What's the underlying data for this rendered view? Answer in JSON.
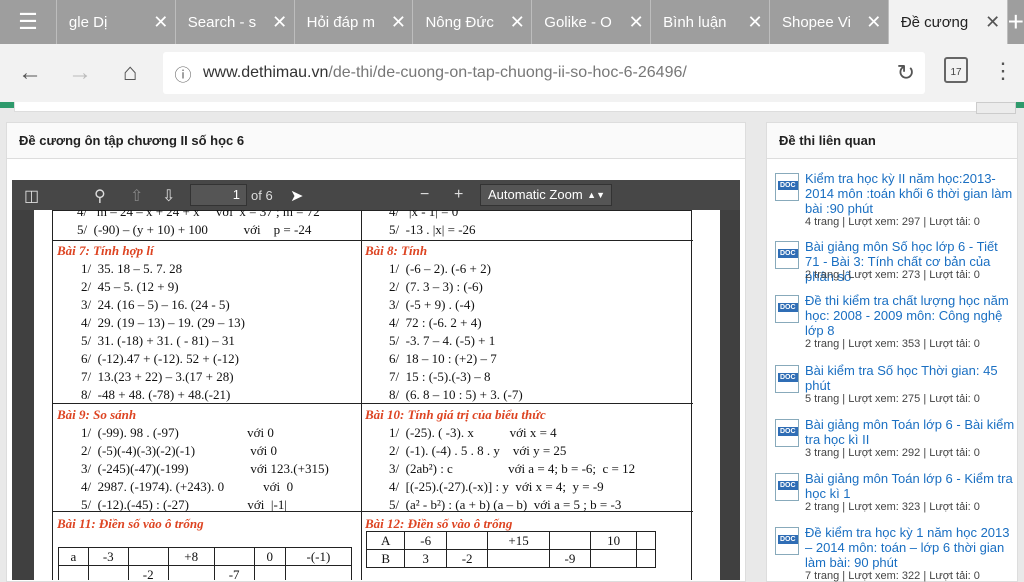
{
  "tabs": [
    {
      "label": "gle Dị"
    },
    {
      "label": "Search - s"
    },
    {
      "label": "Hỏi đáp m"
    },
    {
      "label": "Nông Đức"
    },
    {
      "label": "Golike - O"
    },
    {
      "label": "Bình luận"
    },
    {
      "label": "Shopee Vi"
    },
    {
      "label": "Đề cương"
    }
  ],
  "url": {
    "domain": "www.dethimau.vn",
    "path": "/de-thi/de-cuong-on-tap-chuong-ii-so-hoc-6-26496/"
  },
  "calendar_day": "17",
  "left_title": "Đề cương ôn tập chương II số học 6",
  "viewer": {
    "page": "1",
    "of": "of 6",
    "zoom": "Automatic Zoom"
  },
  "doc": {
    "top_left": [
      "4/   m – 24 – x + 24 + x     với  x = 37 ; m = 72",
      "5/  (-90) – (y + 10) + 100           với    p = -24"
    ],
    "top_right": [
      "4/   |x - 1| = 0",
      "5/  -13 . |x| = -26"
    ],
    "b7_title": "Bài 7:   Tính hợp lí",
    "b7": [
      "1/  35. 18 – 5. 7. 28",
      "2/  45 – 5. (12 + 9)",
      "3/  24. (16 – 5) – 16. (24 - 5)",
      "4/  29. (19 – 13) – 19. (29 – 13)",
      "5/  31. (-18) + 31. ( - 81) – 31",
      "6/  (-12).47 + (-12). 52 + (-12)",
      "7/  13.(23 + 22) – 3.(17 + 28)",
      "8/  -48 + 48. (-78) + 48.(-21)"
    ],
    "b8_title": "Bài 8:   Tính",
    "b8": [
      "1/  (-6 – 2). (-6 + 2)",
      "2/  (7. 3 – 3) : (-6)",
      "3/  (-5 + 9) . (-4)",
      "4/  72 : (-6. 2 + 4)",
      "5/  -3. 7 – 4. (-5) + 1",
      "6/  18 – 10 : (+2) – 7",
      "7/  15 : (-5).(-3) – 8",
      "8/  (6. 8 – 10 : 5) + 3. (-7)"
    ],
    "b9_title": "Bài 9:   So sánh",
    "b9": [
      "1/  (-99). 98 . (-97)                     với 0",
      "2/  (-5)(-4)(-3)(-2)(-1)                 với 0",
      "3/  (-245)(-47)(-199)                   với 123.(+315)",
      "4/  2987. (-1974). (+243). 0            với  0",
      "5/  (-12).(-45) : (-27)                  với  |-1|"
    ],
    "b10_title": "Bài 10:   Tính giá trị của biểu thức",
    "b10": [
      "1/  (-25). ( -3). x           với x = 4",
      "2/  (-1). (-4) . 5 . 8 . y    với y = 25",
      "3/  (2ab²) : c                 với a = 4; b = -6;  c = 12",
      "4/  [(-25).(-27).(-x)] : y  với x = 4;  y = -9",
      "5/  (a² - b²) : (a + b) (a – b)  với a = 5 ; b = -3"
    ],
    "b11_title": "Bài 11:   Điền số vào ô trống",
    "b11_row": [
      "a",
      "-3",
      "",
      "+8",
      "",
      "0",
      "-(-1)"
    ],
    "b11_row2": [
      "",
      "",
      "-2",
      "",
      "-7",
      "",
      ""
    ],
    "b12_title": "Bài 12:   Điền số vào ô trống",
    "b12_rowA": [
      "A",
      "-6",
      "",
      "+15",
      "",
      "10",
      ""
    ],
    "b12_rowB": [
      "B",
      "3",
      "-2",
      "",
      "-9",
      "",
      ""
    ]
  },
  "right_title": "Đề thi liên quan",
  "related": [
    {
      "title": "Kiểm tra học kỳ II năm học:2013- 2014 môn :toán khối 6 thời gian làm bài :90 phút",
      "meta": "4 trang | Lượt xem: 297 | Lượt tải: 0"
    },
    {
      "title": "Bài giảng môn Số học lớp 6 - Tiết 71 - Bài 3: Tính chất cơ bản của phân số",
      "meta": "2 trang | Lượt xem: 273 | Lượt tải: 0"
    },
    {
      "title": "Đề thi kiểm tra chất lượng học năm học: 2008 - 2009 môn: Công nghệ lớp 8",
      "meta": "2 trang | Lượt xem: 353 | Lượt tải: 0"
    },
    {
      "title": "Bài kiểm tra Số học Thời gian: 45 phút",
      "meta": "5 trang | Lượt xem: 275 | Lượt tải: 0"
    },
    {
      "title": "Bài giảng môn Toán lớp 6 - Bài kiểm tra học kì II",
      "meta": "3 trang | Lượt xem: 292 | Lượt tải: 0"
    },
    {
      "title": "Bài giảng môn Toán lớp 6 - Kiểm tra học kì 1",
      "meta": "2 trang | Lượt xem: 323 | Lượt tải: 0"
    },
    {
      "title": "Đề kiểm tra học kỳ 1 năm học 2013 – 2014 môn: toán – lớp 6 thời gian làm bài: 90 phút",
      "meta": "7 trang | Lượt xem: 322 | Lượt tải: 0"
    }
  ],
  "doc_badge": "DOC"
}
